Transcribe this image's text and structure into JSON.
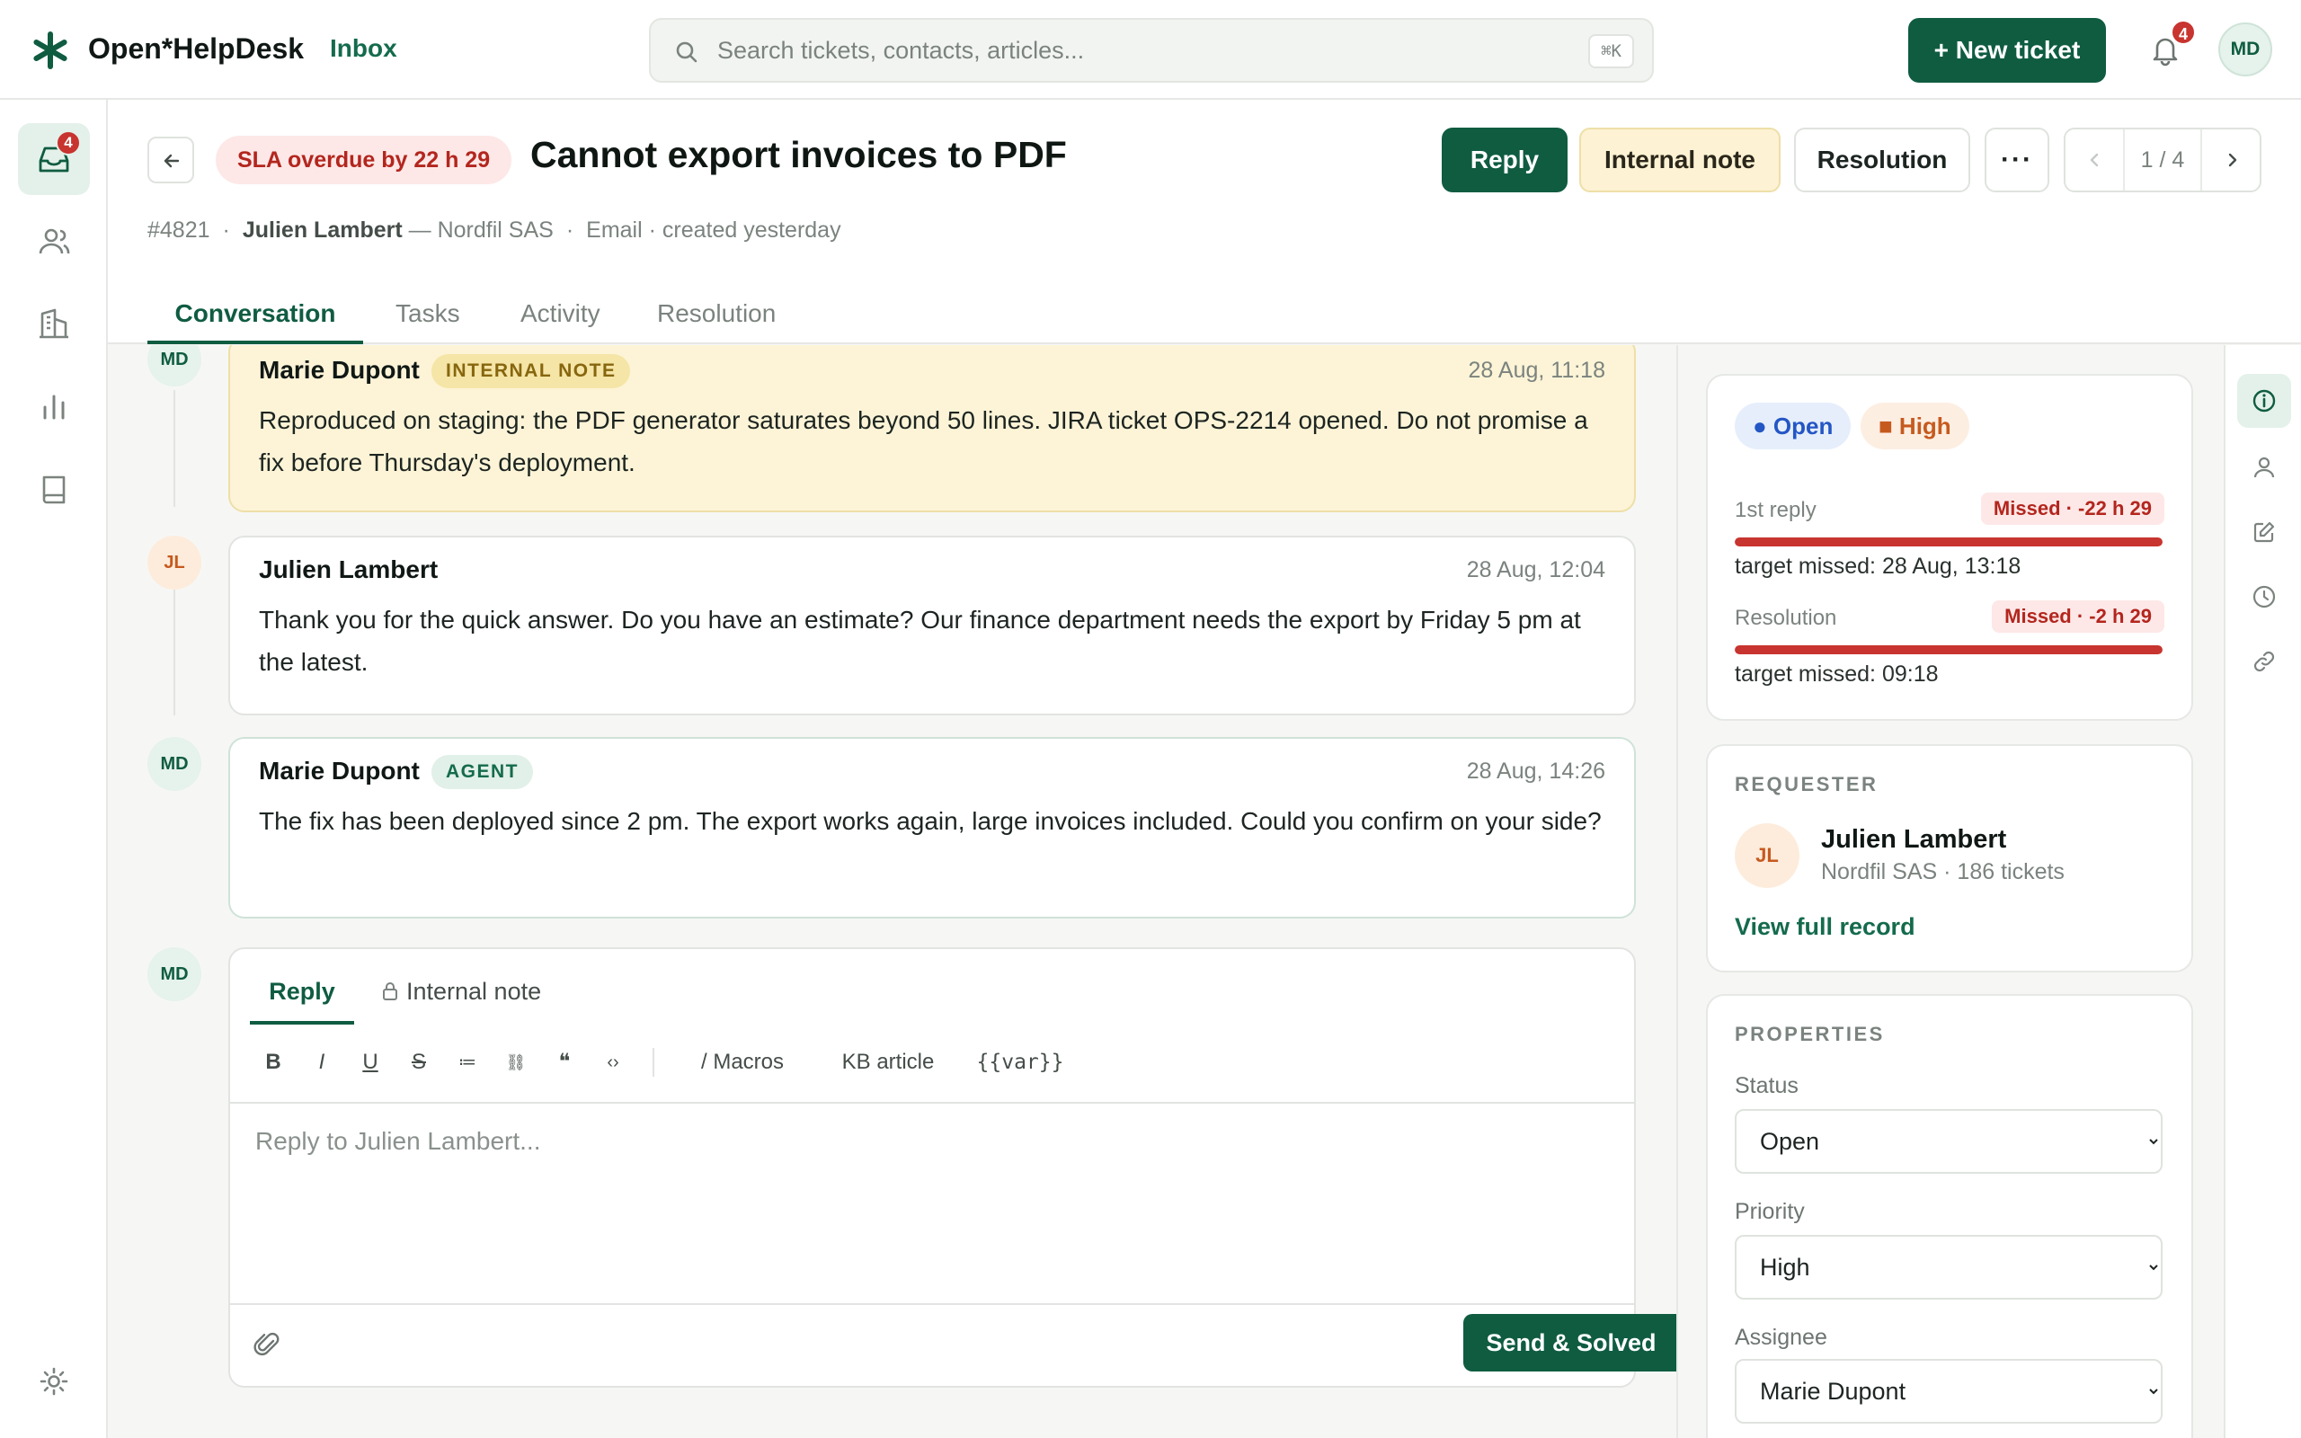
{
  "app": {
    "brand": "Open*HelpDesk",
    "section": "Inbox",
    "search_placeholder": "Search tickets, contacts, articles...",
    "search_shortcut": "⌘K",
    "new_ticket_label": "+ New ticket",
    "notifications_count": "4",
    "user_initials": "MD",
    "accent_color": "#0f5c41"
  },
  "nav": {
    "inbox_badge": "4",
    "items": [
      "inbox-icon",
      "contacts-icon",
      "companies-icon",
      "reports-icon",
      "knowledge-base-icon",
      "settings-icon"
    ]
  },
  "ticket": {
    "sla_badge": "SLA overdue by 22 h 29",
    "title": "Cannot export invoices to PDF",
    "id": "#4821",
    "requester": "Julien Lambert",
    "company_line": "— Nordfil SAS",
    "channel_line": "Email · created yesterday",
    "actions": {
      "reply": "Reply",
      "internal_note": "Internal note",
      "resolution": "Resolution",
      "more": "···"
    },
    "pager": "1 / 4",
    "tabs": [
      "Conversation",
      "Tasks",
      "Activity",
      "Resolution"
    ]
  },
  "messages": [
    {
      "initials": "MD",
      "author": "Marie Dupont",
      "tag": "INTERNAL NOTE",
      "time": "28 Aug, 11:18",
      "body": "Reproduced on staging: the PDF generator saturates beyond 50 lines. JIRA ticket OPS-2214 opened. Do not promise a fix before Thursday's deployment."
    },
    {
      "initials": "JL",
      "author": "Julien Lambert",
      "tag": "",
      "time": "28 Aug, 12:04",
      "body": "Thank you for the quick answer. Do you have an estimate? Our finance department needs the export by Friday 5 pm at the latest."
    },
    {
      "initials": "MD",
      "author": "Marie Dupont",
      "tag": "AGENT",
      "time": "28 Aug, 14:26",
      "body": "The fix has been deployed since 2 pm. The export works again, large invoices included. Could you confirm on your side?"
    }
  ],
  "composer": {
    "initials": "MD",
    "tab_reply": "Reply",
    "tab_note": "Internal note",
    "tools": {
      "bold": "B",
      "italic": "I",
      "underline": "U",
      "strike": "S",
      "list": "≔",
      "link": "⛓",
      "quote": "❝",
      "code": "‹›",
      "macros": "/ Macros",
      "kb": "KB article",
      "var": "{{var}}"
    },
    "placeholder": "Reply to Julien Lambert...",
    "send_label": "Send & Solved",
    "send_caret": "▾"
  },
  "sidebar": {
    "status_pill": "● Open",
    "priority_pill": "■ High",
    "sla": [
      {
        "label": "1st reply",
        "missed": "Missed · -22 h 29",
        "target": "target missed: 28 Aug, 13:18",
        "progress": 1.0
      },
      {
        "label": "Resolution",
        "missed": "Missed · -2 h 29",
        "target": "target missed: 09:18",
        "progress": 1.0
      }
    ],
    "requester_label": "REQUESTER",
    "requester_initials": "JL",
    "requester_name": "Julien Lambert",
    "requester_sub": "Nordfil SAS · 186 tickets",
    "view_record": "View full record",
    "properties_label": "PROPERTIES",
    "status_label": "Status",
    "status_value": "Open",
    "priority_label": "Priority",
    "priority_value": "High",
    "assignee_label": "Assignee",
    "assignee_value": "Marie Dupont"
  }
}
